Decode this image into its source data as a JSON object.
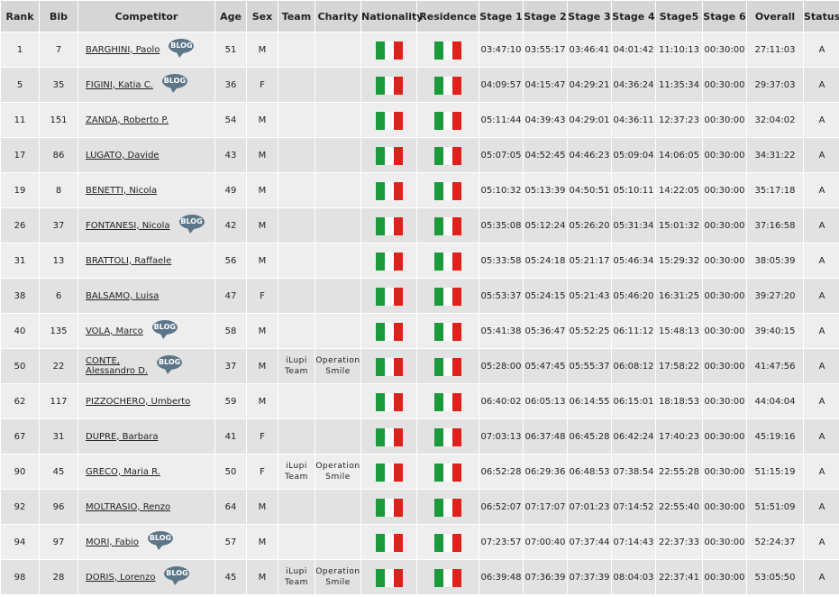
{
  "headers": [
    "Rank",
    "Bib",
    "Competitor",
    "Age",
    "Sex",
    "Team",
    "Charity",
    "Nationality",
    "Residence",
    "Stage 1",
    "Stage 2",
    "Stage 3",
    "Stage 4",
    "Stage5",
    "Stage 6",
    "Overall",
    "Status"
  ],
  "blog_label": "BLOG",
  "flag_colors": [
    "#1a9a3a",
    "#ffffff",
    "#e0201b"
  ],
  "rows": [
    {
      "rank": "1",
      "bib": "7",
      "name": "BARGHINI, Paolo",
      "name2": "",
      "blog": true,
      "age": "51",
      "sex": "M",
      "team": "",
      "team2": "",
      "charity": "",
      "charity2": "",
      "s1": "03:47:10",
      "s2": "03:55:17",
      "s3": "03:46:41",
      "s4": "04:01:42",
      "s5": "11:10:13",
      "s6": "00:30:00",
      "overall": "27:11:03",
      "status": "A"
    },
    {
      "rank": "5",
      "bib": "35",
      "name": "FIGINI, Katia C.",
      "name2": "",
      "blog": true,
      "age": "36",
      "sex": "F",
      "team": "",
      "team2": "",
      "charity": "",
      "charity2": "",
      "s1": "04:09:57",
      "s2": "04:15:47",
      "s3": "04:29:21",
      "s4": "04:36:24",
      "s5": "11:35:34",
      "s6": "00:30:00",
      "overall": "29:37:03",
      "status": "A"
    },
    {
      "rank": "11",
      "bib": "151",
      "name": "ZANDA, Roberto P.",
      "name2": "",
      "blog": false,
      "age": "54",
      "sex": "M",
      "team": "",
      "team2": "",
      "charity": "",
      "charity2": "",
      "s1": "05:11:44",
      "s2": "04:39:43",
      "s3": "04:29:01",
      "s4": "04:36:11",
      "s5": "12:37:23",
      "s6": "00:30:00",
      "overall": "32:04:02",
      "status": "A"
    },
    {
      "rank": "17",
      "bib": "86",
      "name": "LUGATO, Davide",
      "name2": "",
      "blog": false,
      "age": "43",
      "sex": "M",
      "team": "",
      "team2": "",
      "charity": "",
      "charity2": "",
      "s1": "05:07:05",
      "s2": "04:52:45",
      "s3": "04:46:23",
      "s4": "05:09:04",
      "s5": "14:06:05",
      "s6": "00:30:00",
      "overall": "34:31:22",
      "status": "A"
    },
    {
      "rank": "19",
      "bib": "8",
      "name": "BENETTI, Nicola",
      "name2": "",
      "blog": false,
      "age": "49",
      "sex": "M",
      "team": "",
      "team2": "",
      "charity": "",
      "charity2": "",
      "s1": "05:10:32",
      "s2": "05:13:39",
      "s3": "04:50:51",
      "s4": "05:10:11",
      "s5": "14:22:05",
      "s6": "00:30:00",
      "overall": "35:17:18",
      "status": "A"
    },
    {
      "rank": "26",
      "bib": "37",
      "name": "FONTANESI, Nicola",
      "name2": "",
      "blog": true,
      "age": "42",
      "sex": "M",
      "team": "",
      "team2": "",
      "charity": "",
      "charity2": "",
      "s1": "05:35:08",
      "s2": "05:12:24",
      "s3": "05:26:20",
      "s4": "05:31:34",
      "s5": "15:01:32",
      "s6": "00:30:00",
      "overall": "37:16:58",
      "status": "A"
    },
    {
      "rank": "31",
      "bib": "13",
      "name": "BRATTOLI, Raffaele",
      "name2": "",
      "blog": false,
      "age": "56",
      "sex": "M",
      "team": "",
      "team2": "",
      "charity": "",
      "charity2": "",
      "s1": "05:33:58",
      "s2": "05:24:18",
      "s3": "05:21:17",
      "s4": "05:46:34",
      "s5": "15:29:32",
      "s6": "00:30:00",
      "overall": "38:05:39",
      "status": "A"
    },
    {
      "rank": "38",
      "bib": "6",
      "name": "BALSAMO, Luisa",
      "name2": "",
      "blog": false,
      "age": "47",
      "sex": "F",
      "team": "",
      "team2": "",
      "charity": "",
      "charity2": "",
      "s1": "05:53:37",
      "s2": "05:24:15",
      "s3": "05:21:43",
      "s4": "05:46:20",
      "s5": "16:31:25",
      "s6": "00:30:00",
      "overall": "39:27:20",
      "status": "A"
    },
    {
      "rank": "40",
      "bib": "135",
      "name": "VOLA, Marco",
      "name2": "",
      "blog": true,
      "age": "58",
      "sex": "M",
      "team": "",
      "team2": "",
      "charity": "",
      "charity2": "",
      "s1": "05:41:38",
      "s2": "05:36:47",
      "s3": "05:52:25",
      "s4": "06:11:12",
      "s5": "15:48:13",
      "s6": "00:30:00",
      "overall": "39:40:15",
      "status": "A"
    },
    {
      "rank": "50",
      "bib": "22",
      "name": "CONTE,",
      "name2": "Alessandro D.",
      "blog": true,
      "age": "37",
      "sex": "M",
      "team": "iLupi",
      "team2": "Team",
      "charity": "Operation",
      "charity2": "Smile",
      "s1": "05:28:00",
      "s2": "05:47:45",
      "s3": "05:55:37",
      "s4": "06:08:12",
      "s5": "17:58:22",
      "s6": "00:30:00",
      "overall": "41:47:56",
      "status": "A"
    },
    {
      "rank": "62",
      "bib": "117",
      "name": "PIZZOCHERO, Umberto",
      "name2": "",
      "blog": false,
      "age": "59",
      "sex": "M",
      "team": "",
      "team2": "",
      "charity": "",
      "charity2": "",
      "s1": "06:40:02",
      "s2": "06:05:13",
      "s3": "06:14:55",
      "s4": "06:15:01",
      "s5": "18:18:53",
      "s6": "00:30:00",
      "overall": "44:04:04",
      "status": "A"
    },
    {
      "rank": "67",
      "bib": "31",
      "name": "DUPRE, Barbara",
      "name2": "",
      "blog": false,
      "age": "41",
      "sex": "F",
      "team": "",
      "team2": "",
      "charity": "",
      "charity2": "",
      "s1": "07:03:13",
      "s2": "06:37:48",
      "s3": "06:45:28",
      "s4": "06:42:24",
      "s5": "17:40:23",
      "s6": "00:30:00",
      "overall": "45:19:16",
      "status": "A"
    },
    {
      "rank": "90",
      "bib": "45",
      "name": "GRECO, Maria R.",
      "name2": "",
      "blog": false,
      "age": "50",
      "sex": "F",
      "team": "iLupi",
      "team2": "Team",
      "charity": "Operation",
      "charity2": "Smile",
      "s1": "06:52:28",
      "s2": "06:29:36",
      "s3": "06:48:53",
      "s4": "07:38:54",
      "s5": "22:55:28",
      "s6": "00:30:00",
      "overall": "51:15:19",
      "status": "A"
    },
    {
      "rank": "92",
      "bib": "96",
      "name": "MOLTRASIO, Renzo",
      "name2": "",
      "blog": false,
      "age": "64",
      "sex": "M",
      "team": "",
      "team2": "",
      "charity": "",
      "charity2": "",
      "s1": "06:52:07",
      "s2": "07:17:07",
      "s3": "07:01:23",
      "s4": "07:14:52",
      "s5": "22:55:40",
      "s6": "00:30:00",
      "overall": "51:51:09",
      "status": "A"
    },
    {
      "rank": "94",
      "bib": "97",
      "name": "MORI, Fabio",
      "name2": "",
      "blog": true,
      "age": "57",
      "sex": "M",
      "team": "",
      "team2": "",
      "charity": "",
      "charity2": "",
      "s1": "07:23:57",
      "s2": "07:00:40",
      "s3": "07:37:44",
      "s4": "07:14:43",
      "s5": "22:37:33",
      "s6": "00:30:00",
      "overall": "52:24:37",
      "status": "A"
    },
    {
      "rank": "98",
      "bib": "28",
      "name": "DORIS, Lorenzo",
      "name2": "",
      "blog": true,
      "age": "45",
      "sex": "M",
      "team": "iLupi",
      "team2": "Team",
      "charity": "Operation",
      "charity2": "Smile",
      "s1": "06:39:48",
      "s2": "07:36:39",
      "s3": "07:37:39",
      "s4": "08:04:03",
      "s5": "22:37:41",
      "s6": "00:30:00",
      "overall": "53:05:50",
      "status": "A"
    }
  ]
}
